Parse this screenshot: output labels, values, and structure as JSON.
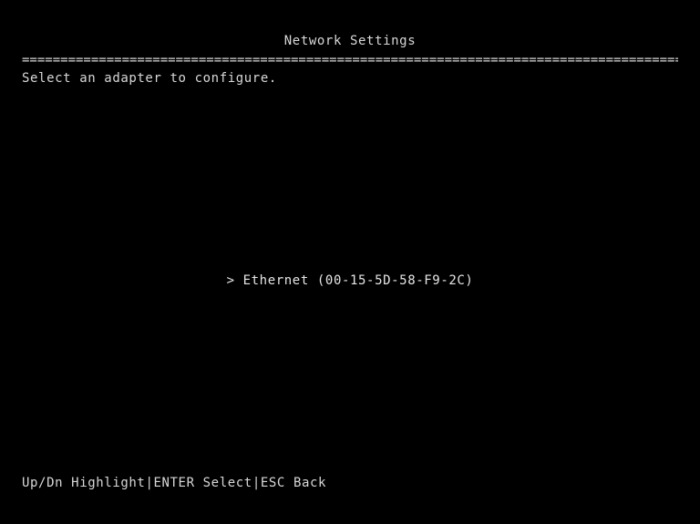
{
  "header": {
    "title": "Network Settings",
    "separator": "=========================================================================================="
  },
  "main": {
    "prompt": "Select an adapter to configure.",
    "adapters": [
      {
        "marker": "> ",
        "label": "Ethernet (00-15-5D-58-F9-2C)",
        "selected": true
      }
    ]
  },
  "footer": {
    "hints": [
      {
        "label": "Up/Dn Highlight"
      },
      {
        "separator": "|"
      },
      {
        "label": "ENTER Select"
      },
      {
        "separator": "|"
      },
      {
        "label": "ESC Back"
      }
    ],
    "hint_updown": "Up/Dn Highlight",
    "hint_enter": "ENTER Select",
    "hint_esc": "ESC Back",
    "divider": "|"
  },
  "colors": {
    "background": "#000000",
    "text": "#d8d8d8"
  }
}
